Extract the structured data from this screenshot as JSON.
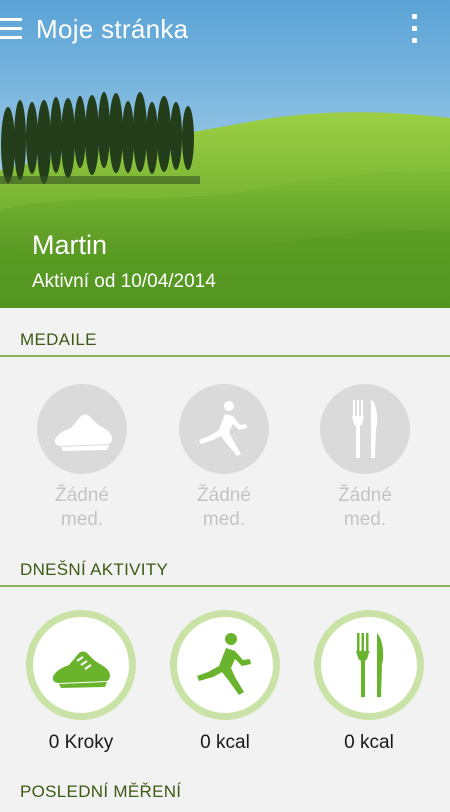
{
  "appbar": {
    "title": "Moje stránka",
    "menu_icon": "menu-icon",
    "overflow_icon": "overflow-icon"
  },
  "profile": {
    "name": "Martin",
    "active_since": "Aktivní od 10/04/2014"
  },
  "medals": {
    "title": "MEDAILE",
    "items": [
      {
        "icon": "shoe-icon",
        "line1": "Žádné",
        "line2": "med."
      },
      {
        "icon": "runner-icon",
        "line1": "Žádné",
        "line2": "med."
      },
      {
        "icon": "fork-knife-icon",
        "line1": "Žádné",
        "line2": "med."
      }
    ]
  },
  "activities": {
    "title": "DNEŠNÍ AKTIVITY",
    "items": [
      {
        "icon": "shoe-icon",
        "label": "0 Kroky"
      },
      {
        "icon": "runner-icon",
        "label": "0 kcal"
      },
      {
        "icon": "fork-knife-icon",
        "label": "0 kcal"
      }
    ]
  },
  "last_measurement": {
    "title": "POSLEDNÍ MĚŘENÍ"
  },
  "colors": {
    "accent_green": "#6ab42d",
    "ring_green": "#c9e3a6",
    "section_text": "#3b5a12",
    "divider": "#8ab45a",
    "medal_gray": "#dadada"
  }
}
